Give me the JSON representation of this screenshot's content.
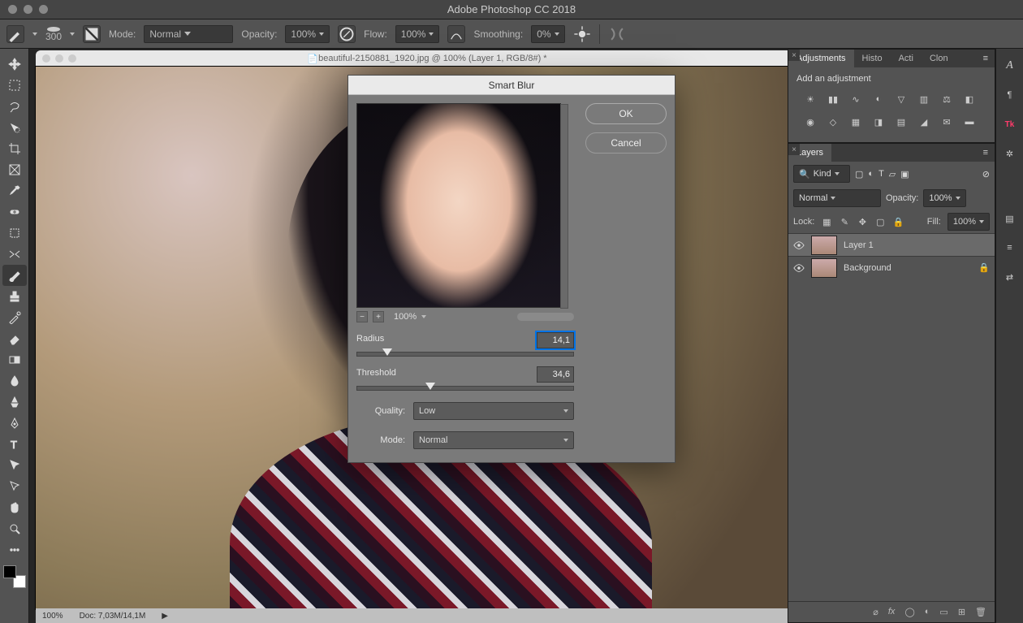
{
  "app": {
    "title": "Adobe Photoshop CC 2018"
  },
  "options": {
    "brush_size": "300",
    "mode_label": "Mode:",
    "mode_value": "Normal",
    "opacity_label": "Opacity:",
    "opacity_value": "100%",
    "flow_label": "Flow:",
    "flow_value": "100%",
    "smoothing_label": "Smoothing:",
    "smoothing_value": "0%"
  },
  "document": {
    "tab_title": "beautiful-2150881_1920.jpg @ 100% (Layer 1, RGB/8#) *",
    "zoom": "100%",
    "doc_info": "Doc: 7,03M/14,1M"
  },
  "dialog": {
    "title": "Smart Blur",
    "ok": "OK",
    "cancel": "Cancel",
    "zoom": "100%",
    "radius_label": "Radius",
    "radius_value": "14,1",
    "radius_pct": 14,
    "threshold_label": "Threshold",
    "threshold_value": "34,6",
    "threshold_pct": 34,
    "quality_label": "Quality:",
    "quality_value": "Low",
    "mode_label": "Mode:",
    "mode_value": "Normal"
  },
  "panels": {
    "adjustments": {
      "tab": "Adjustments",
      "other_tabs": [
        "Histo",
        "Acti",
        "Clon"
      ],
      "heading": "Add an adjustment"
    },
    "layers": {
      "tab": "Layers",
      "filter_label": "Kind",
      "blend_mode": "Normal",
      "opacity_label": "Opacity:",
      "opacity_value": "100%",
      "lock_label": "Lock:",
      "fill_label": "Fill:",
      "fill_value": "100%",
      "items": [
        {
          "name": "Layer 1",
          "locked": false,
          "selected": true
        },
        {
          "name": "Background",
          "locked": true,
          "selected": false
        }
      ]
    }
  }
}
